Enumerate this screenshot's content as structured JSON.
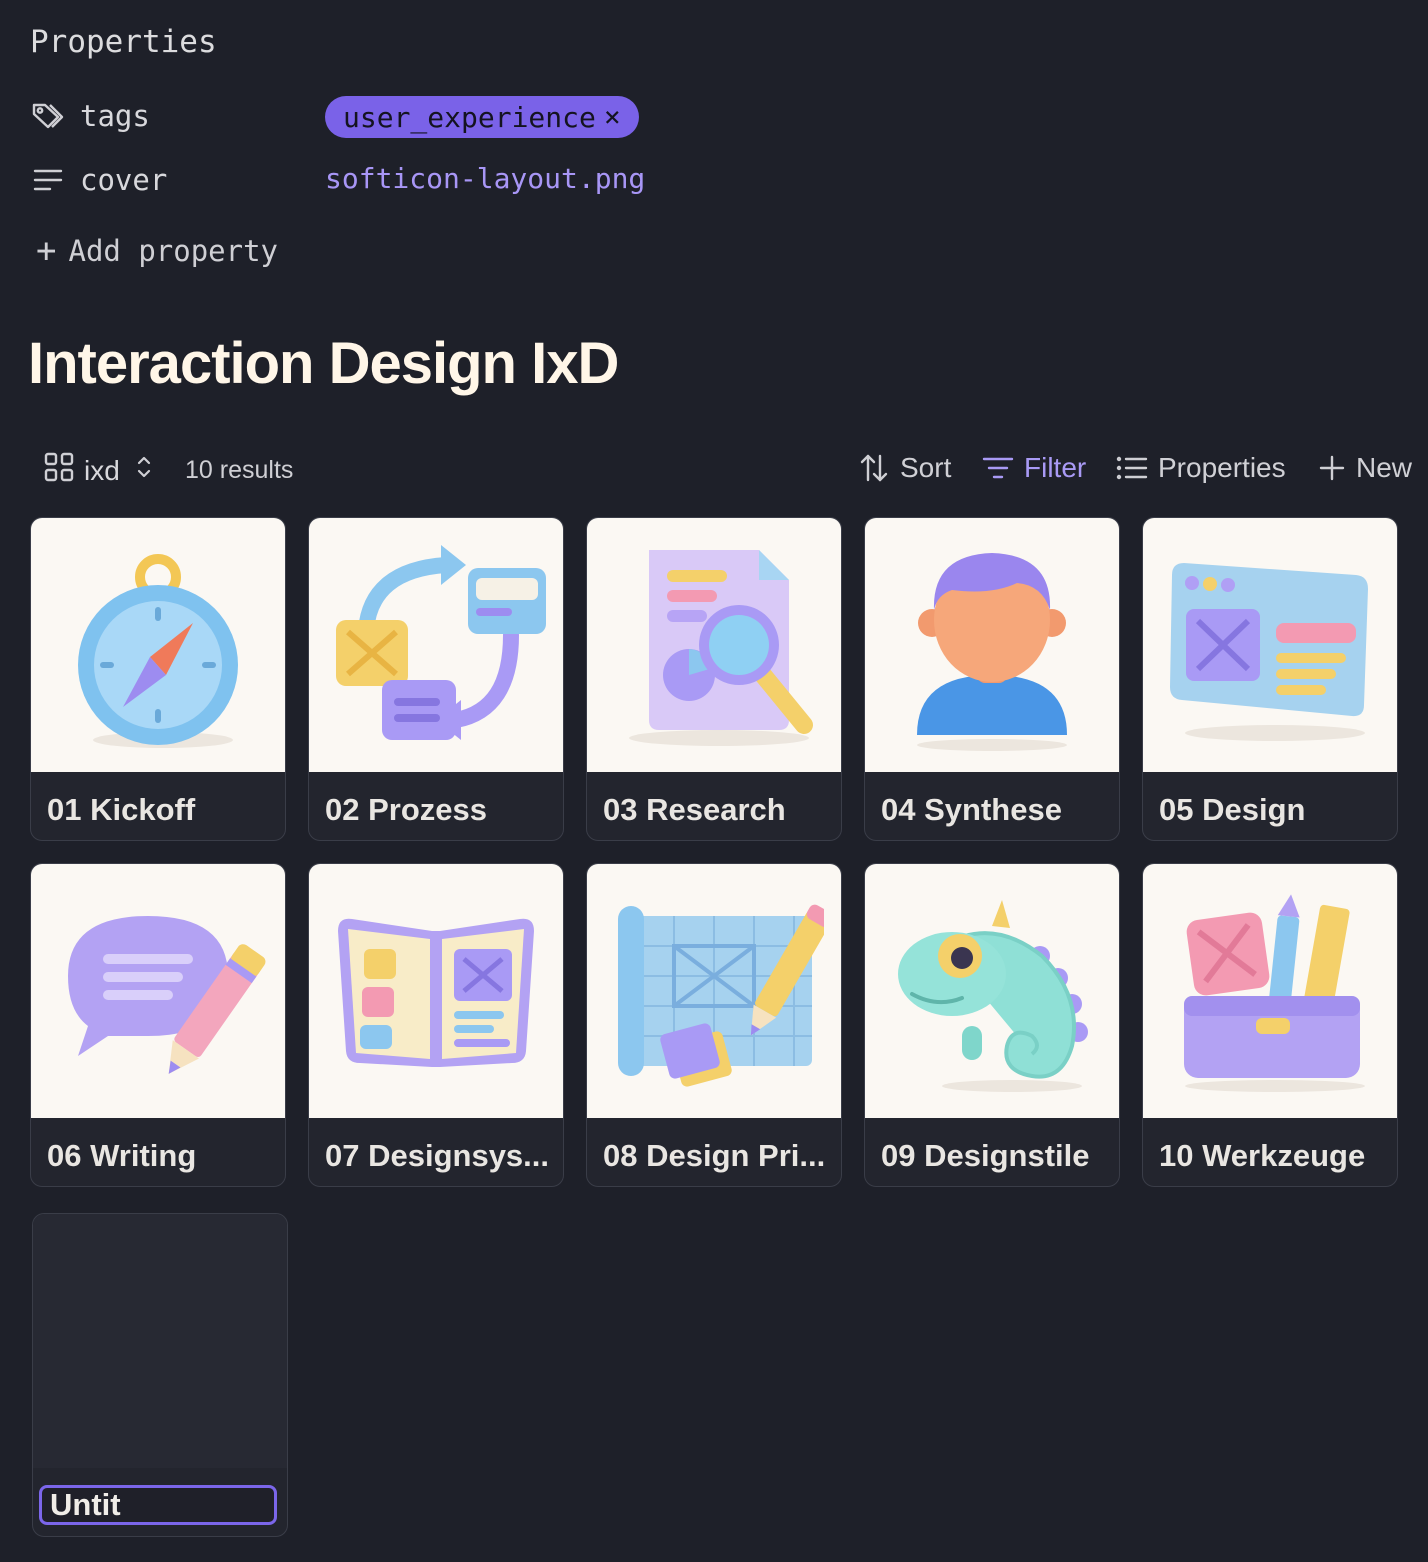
{
  "properties": {
    "title": "Properties",
    "tags_label": "tags",
    "tag_value": "user_experience",
    "tag_remove": "×",
    "cover_label": "cover",
    "cover_value": "softicon-layout.png",
    "add_property": "Add property"
  },
  "page_title": "Interaction Design IxD",
  "toolbar": {
    "view_name": "ixd",
    "results": "10 results",
    "sort": "Sort",
    "filter": "Filter",
    "properties": "Properties",
    "new": "New"
  },
  "cards": [
    {
      "label": "01 Kickoff",
      "icon": "compass-icon"
    },
    {
      "label": "02 Prozess",
      "icon": "process-cycle-icon"
    },
    {
      "label": "03 Research",
      "icon": "document-search-icon"
    },
    {
      "label": "04 Synthese",
      "icon": "person-icon"
    },
    {
      "label": "05 Design",
      "icon": "browser-layout-icon"
    },
    {
      "label": "06 Writing",
      "icon": "chat-pencil-icon"
    },
    {
      "label": "07 Designsys...",
      "icon": "open-book-icon"
    },
    {
      "label": "08 Design Pri...",
      "icon": "blueprint-pencil-icon"
    },
    {
      "label": "09 Designstile",
      "icon": "chameleon-icon"
    },
    {
      "label": "10 Werkzeuge",
      "icon": "toolbox-icon"
    }
  ],
  "new_card": {
    "input_value": "Untit"
  },
  "colors": {
    "accent": "#7a62e8",
    "link": "#a896f6",
    "background": "#1e2029",
    "title": "#fff6e8"
  }
}
